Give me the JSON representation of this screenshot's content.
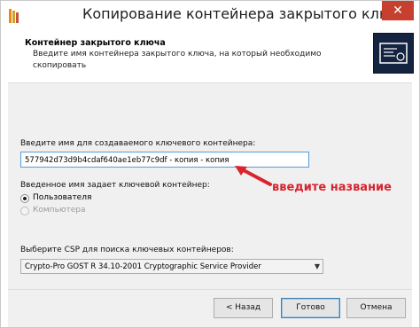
{
  "window": {
    "title": "Копирование контейнера закрытого ключа",
    "close_glyph": "✕"
  },
  "header": {
    "title": "Контейнер закрытого ключа",
    "description": "Введите имя контейнера закрытого ключа, на который необходимо скопировать"
  },
  "form": {
    "name_label": "Введите имя для создаваемого ключевого контейнера:",
    "name_value": "577942d73d9b4cdaf640ae1eb77c9df - копия - копия",
    "keyset_label": "Введенное имя задает ключевой контейнер:",
    "radio_user": "Пользователя",
    "radio_computer": "Компьютера",
    "csp_label": "Выберите CSP для поиска ключевых контейнеров:",
    "csp_value": "Crypto-Pro GOST R 34.10-2001 Cryptographic Service Provider"
  },
  "annotation": {
    "text": "введите название",
    "color": "#d9232f"
  },
  "buttons": {
    "back": "< Назад",
    "done": "Готово",
    "cancel": "Отмена"
  },
  "colors": {
    "accent": "#5b9bd5",
    "close": "#c7402f",
    "header_icon_bg": "#14233f"
  },
  "icons": {
    "app": "crypto-pro-logo-icon",
    "close": "close-icon",
    "header": "certificate-icon",
    "dropdown": "chevron-down-icon",
    "annotation": "red-arrow-icon"
  }
}
